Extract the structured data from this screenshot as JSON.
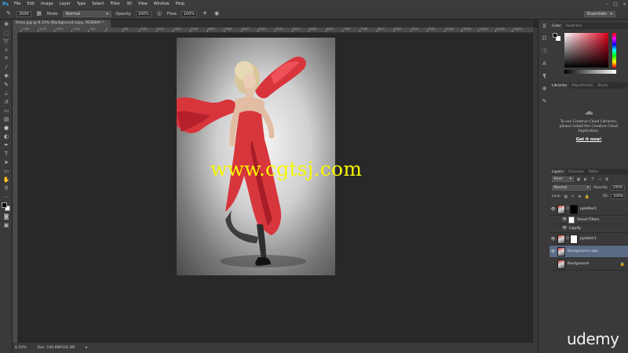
{
  "app": {
    "logo": "Ps",
    "menu": [
      "File",
      "Edit",
      "Image",
      "Layer",
      "Type",
      "Select",
      "Filter",
      "3D",
      "View",
      "Window",
      "Help"
    ],
    "window_controls": [
      "–",
      "□",
      "×"
    ]
  },
  "options_bar": {
    "tool_icon": "brush-icon",
    "brush_size": "2000",
    "mode_label": "Mode:",
    "mode_value": "Normal",
    "opacity_label": "Opacity:",
    "opacity_value": "100%",
    "flow_label": "Flow:",
    "flow_value": "100%",
    "workspace": "Essentials"
  },
  "document": {
    "tab_title": "three.jpg @ 8.33% (Background copy, RGB/8#) *",
    "ruler_numbers": [
      "-2500",
      "-2000",
      "-1500",
      "-1000",
      "-500",
      "0",
      "500",
      "1000",
      "1500",
      "2000",
      "2500",
      "3000",
      "3500",
      "4000",
      "4500",
      "5000",
      "5500",
      "6000",
      "6500",
      "7000",
      "7500",
      "8000",
      "8500",
      "9000",
      "9500",
      "10000",
      "10500",
      "11000",
      "11500",
      "12000"
    ],
    "zoom_status": "8.33%",
    "doc_status": "Doc: 140.6M/526.3M",
    "watermark": "www.cgtsj.com"
  },
  "tools": [
    "move-icon",
    "marquee-icon",
    "lasso-icon",
    "quick-select-icon",
    "crop-icon",
    "eyedropper-icon",
    "healing-icon",
    "brush-icon",
    "stamp-icon",
    "history-brush-icon",
    "eraser-icon",
    "gradient-icon",
    "blur-icon",
    "dodge-icon",
    "pen-icon",
    "type-icon",
    "path-select-icon",
    "shape-icon",
    "hand-icon",
    "zoom-icon"
  ],
  "color_panel": {
    "tabs": [
      "Color",
      "Swatches"
    ],
    "fg_color": "#000000",
    "bg_color": "#ffffff"
  },
  "libraries_panel": {
    "tabs": [
      "Libraries",
      "Adjustments",
      "Styles"
    ],
    "message": "To use Creative Cloud Libraries,\nplease install the Creative Cloud\nApplication.",
    "link": "Get it now!"
  },
  "layers_panel": {
    "tabs": [
      "Layers",
      "Channels",
      "Paths"
    ],
    "kind_label": "Kind",
    "blend_mode": "Normal",
    "opacity_label": "Opacity:",
    "opacity_value": "100%",
    "lock_label": "Lock:",
    "fill_label": "Fill:",
    "fill_value": "100%",
    "layers": [
      {
        "name": "pplatter2",
        "type": "smart"
      },
      {
        "name": "pplatter1",
        "type": "smart"
      },
      {
        "name": "Background copy",
        "type": "normal",
        "selected": true
      },
      {
        "name": "Background",
        "type": "locked"
      }
    ],
    "smart_filters_label": "Smart Filters",
    "liquify_label": "Liquify"
  },
  "branding": "udemy"
}
